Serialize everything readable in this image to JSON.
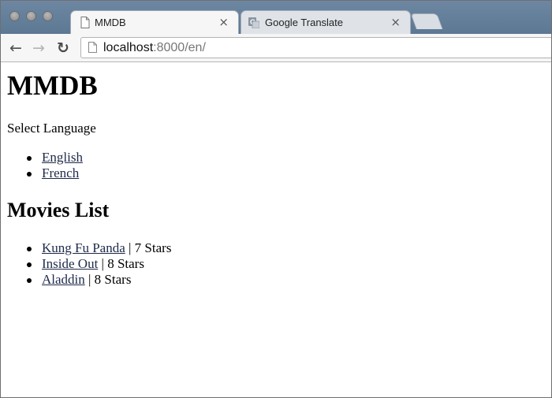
{
  "browser": {
    "tabs": [
      {
        "title": "MMDB",
        "close_glyph": "×",
        "icon": "page-icon",
        "active": true
      },
      {
        "title": "Google Translate",
        "close_glyph": "×",
        "icon": "google-translate-icon",
        "active": false
      }
    ],
    "nav": {
      "back_glyph": "←",
      "forward_glyph": "→",
      "reload_glyph": "↻"
    },
    "url": {
      "host": "localhost",
      "rest": ":8000/en/"
    }
  },
  "page": {
    "title": "MMDB",
    "select_language_label": "Select Language",
    "languages": [
      {
        "label": "English"
      },
      {
        "label": "French"
      }
    ],
    "movies_heading": "Movies List",
    "movies": [
      {
        "name": "Kung Fu Panda",
        "rating": " | 7 Stars"
      },
      {
        "name": "Inside Out",
        "rating": " | 8 Stars"
      },
      {
        "name": "Aladdin",
        "rating": " | 8 Stars"
      }
    ]
  },
  "colors": {
    "tabstrip": "#6d87a3",
    "link": "#1e2a4a",
    "reload_icon": "#4a4a4a",
    "back_icon": "#4f4f4f",
    "forward_icon": "#b4b4b4"
  }
}
